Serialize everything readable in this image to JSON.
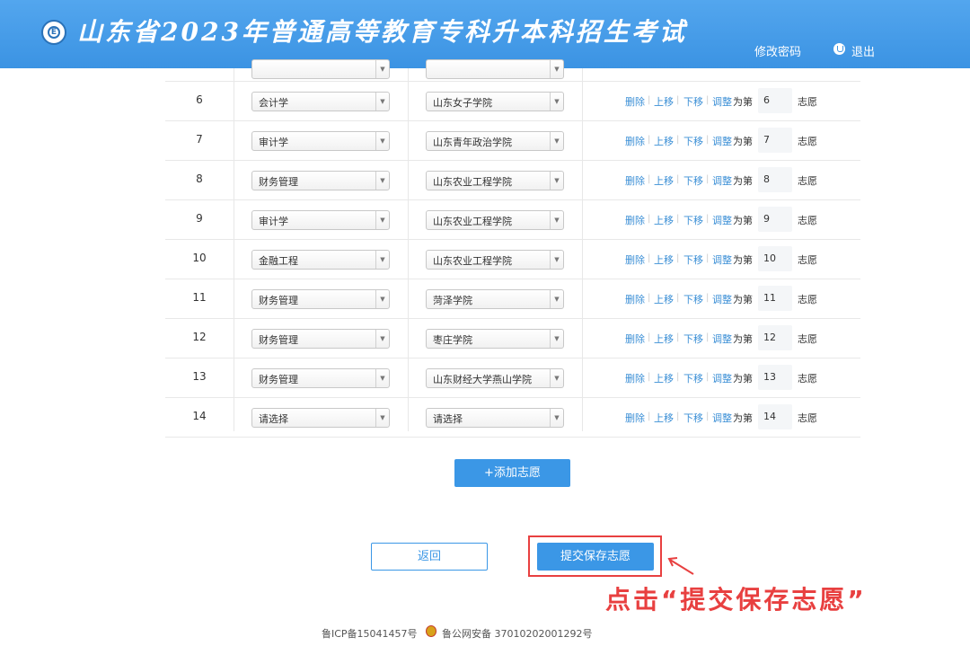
{
  "header": {
    "title": "山东省2023年普通高等教育专科升本科招生考试",
    "change_password": "修改密码",
    "logout": "退出"
  },
  "rows": [
    {
      "num": "6",
      "major": "会计学",
      "school": "山东女子学院",
      "rank": "6"
    },
    {
      "num": "7",
      "major": "审计学",
      "school": "山东青年政治学院",
      "rank": "7"
    },
    {
      "num": "8",
      "major": "财务管理",
      "school": "山东农业工程学院",
      "rank": "8"
    },
    {
      "num": "9",
      "major": "审计学",
      "school": "山东农业工程学院",
      "rank": "9"
    },
    {
      "num": "10",
      "major": "金融工程",
      "school": "山东农业工程学院",
      "rank": "10"
    },
    {
      "num": "11",
      "major": "财务管理",
      "school": "菏泽学院",
      "rank": "11"
    },
    {
      "num": "12",
      "major": "财务管理",
      "school": "枣庄学院",
      "rank": "12"
    },
    {
      "num": "13",
      "major": "财务管理",
      "school": "山东财经大学燕山学院",
      "rank": "13"
    },
    {
      "num": "14",
      "major": "请选择",
      "school": "请选择",
      "rank": "14"
    }
  ],
  "actions": {
    "delete": "删除",
    "up": "上移",
    "down": "下移",
    "adjust": "调整",
    "to_rank": "为第",
    "choice": "志愿"
  },
  "buttons": {
    "add": "+添加志愿",
    "back": "返回",
    "submit": "提交保存志愿"
  },
  "annotation": "点击“提交保存志愿”",
  "footer": {
    "icp": "鲁ICP备15041457号",
    "police": "鲁公网安备 37010202001292号"
  },
  "colors": {
    "header": "#3b93e3",
    "button": "#3b97e6",
    "link": "#3b8fd6",
    "annotation": "#e84040"
  }
}
